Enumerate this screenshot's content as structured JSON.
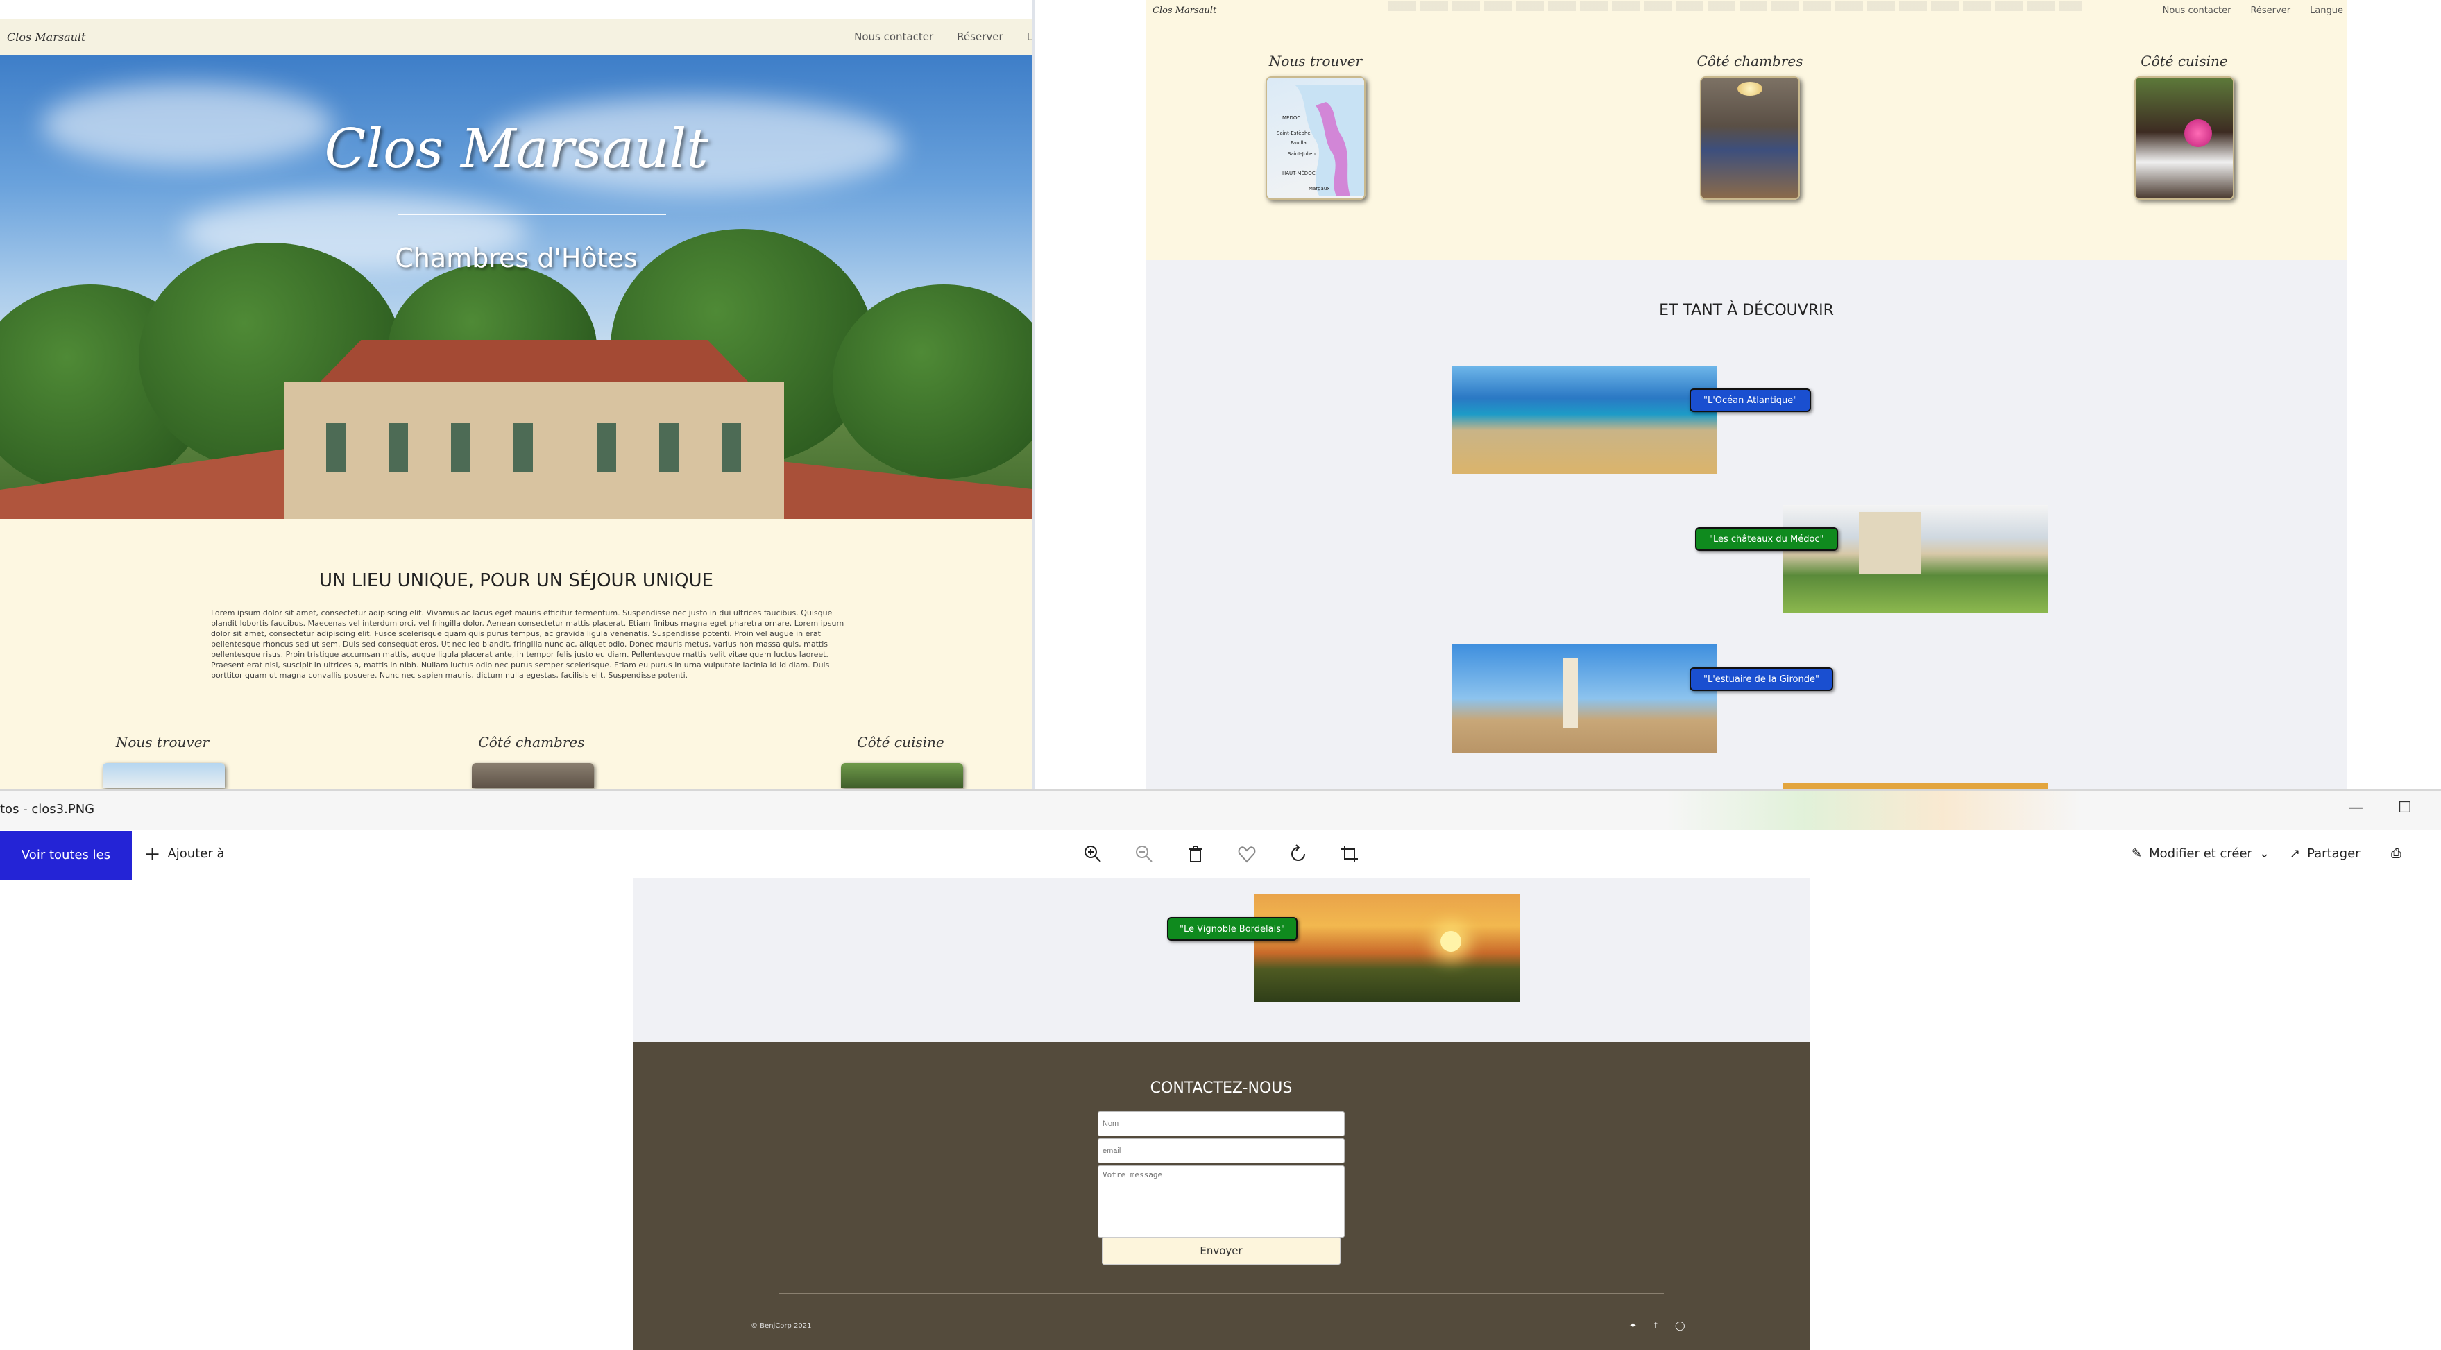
{
  "site": {
    "logo": "Clos Marsault",
    "nav": [
      "Nous contacter",
      "Réserver",
      "Langue"
    ],
    "nav_cut": "L",
    "hero_title": "Clos Marsault",
    "hero_subtitle": "Chambres d'Hôtes",
    "section_title": "UN LIEU UNIQUE, POUR UN SÉJOUR UNIQUE",
    "lorem": "Lorem ipsum dolor sit amet, consectetur adipiscing elit. Vivamus ac lacus eget mauris efficitur fermentum. Suspendisse nec justo in dui ultrices faucibus. Quisque blandit lobortis faucibus. Maecenas vel interdum orci, vel fringilla dolor. Aenean consectetur mattis placerat. Etiam finibus magna eget pharetra ornare. Lorem ipsum dolor sit amet, consectetur adipiscing elit. Fusce scelerisque quam quis purus tempus, ac gravida ligula venenatis. Suspendisse potenti. Proin vel augue in erat pellentesque rhoncus sed ut sem. Duis sed consequat eros. Ut nec leo blandit, fringilla nunc ac, aliquet odio. Donec mauris metus, varius non massa quis, mattis pellentesque risus. Proin tristique accumsan mattis, augue ligula placerat ante, in tempor felis justo eu diam. Pellentesque mattis velit vitae quam luctus laoreet. Praesent erat nisl, suscipit in ultrices a, mattis in nibh. Nullam luctus odio nec purus semper scelerisque. Etiam eu purus in urna vulputate lacinia id id diam. Duis porttitor quam ut magna convallis posuere. Nunc nec sapien mauris, dictum nulla egestas, facilisis elit. Suspendisse potenti.",
    "cards": [
      "Nous trouver",
      "Côté chambres",
      "Côté cuisine"
    ],
    "discover_title": "ET TANT À DÉCOUVRIR",
    "discover": [
      {
        "label": "\"L'Océan Atlantique\"",
        "color": "#1a4fd0"
      },
      {
        "label": "\"Les châteaux du Médoc\"",
        "color": "#0f8a1e"
      },
      {
        "label": "\"L'estuaire de la Gironde\"",
        "color": "#1a4fd0"
      },
      {
        "label": "\"Le Vignoble Bordelais\"",
        "color": "#0f8a1e"
      }
    ],
    "map_labels": [
      "MÉDOC",
      "Saint-Estèphe",
      "Pauillac",
      "Saint-Julien",
      "HAUT-MÉDOC",
      "Margaux"
    ],
    "contact_title": "CONTACTEZ-NOUS",
    "contact_name_placeholder": "Nom",
    "contact_email_placeholder": "email",
    "contact_message_placeholder": "Votre message",
    "contact_send": "Envoyer",
    "copyright": "© BenjCorp 2021",
    "social_icons": [
      "twitter-icon",
      "facebook-icon",
      "instagram-icon"
    ]
  },
  "photos_app": {
    "window_title": "tos - clos3.PNG",
    "view_all": "Voir toutes les photos",
    "add_to": "Ajouter à",
    "edit_create": "Modifier et créer",
    "share": "Partager",
    "toolbar_icons": [
      "zoom-in-icon",
      "zoom-out-icon",
      "delete-icon",
      "favorite-icon",
      "rotate-icon",
      "crop-icon"
    ]
  }
}
